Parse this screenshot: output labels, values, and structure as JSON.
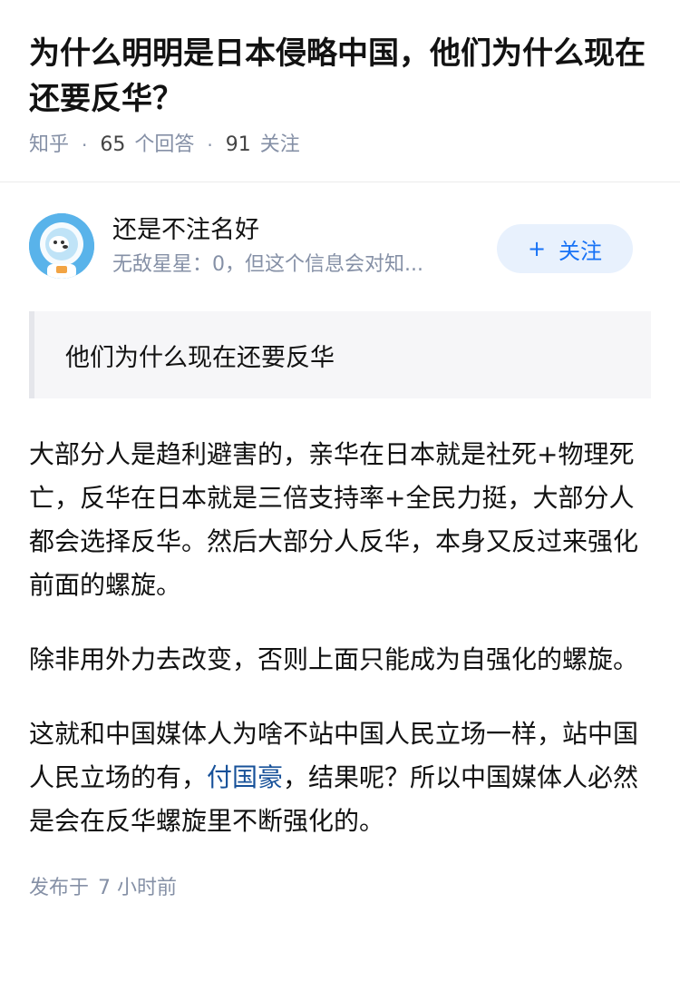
{
  "question": {
    "title": "为什么明明是日本侵略中国，他们为什么现在还要反华？",
    "site": "知乎",
    "answer_count": "65",
    "answer_label": "个回答",
    "follower_count": "91",
    "follower_label": "关注"
  },
  "author": {
    "name": "还是不注名好",
    "bio": "无敌星星：0，但这个信息会对知...",
    "follow_label": "关注",
    "follow_icon": "plus-icon"
  },
  "quote": "他们为什么现在还要反华",
  "answer": {
    "p1": "大部分人是趋利避害的，亲华在日本就是社死+物理死亡，反华在日本就是三倍支持率+全民力挺，大部分人都会选择反华。然后大部分人反华，本身又反过来强化前面的螺旋。",
    "p2": "除非用外力去改变，否则上面只能成为自强化的螺旋。",
    "p3_before": "这就和中国媒体人为啥不站中国人民立场一样，站中国人民立场的有，",
    "p3_link": "付国豪",
    "p3_after": "，结果呢？所以中国媒体人必然是会在反华螺旋里不断强化的。"
  },
  "publish": {
    "label": "发布于",
    "time": "7 小时前"
  },
  "colors": {
    "link": "#175199",
    "follow_text": "#1772f6",
    "follow_bg": "#e8f1fd",
    "meta": "#8590a6",
    "avatar_bg": "#59b3ea"
  }
}
